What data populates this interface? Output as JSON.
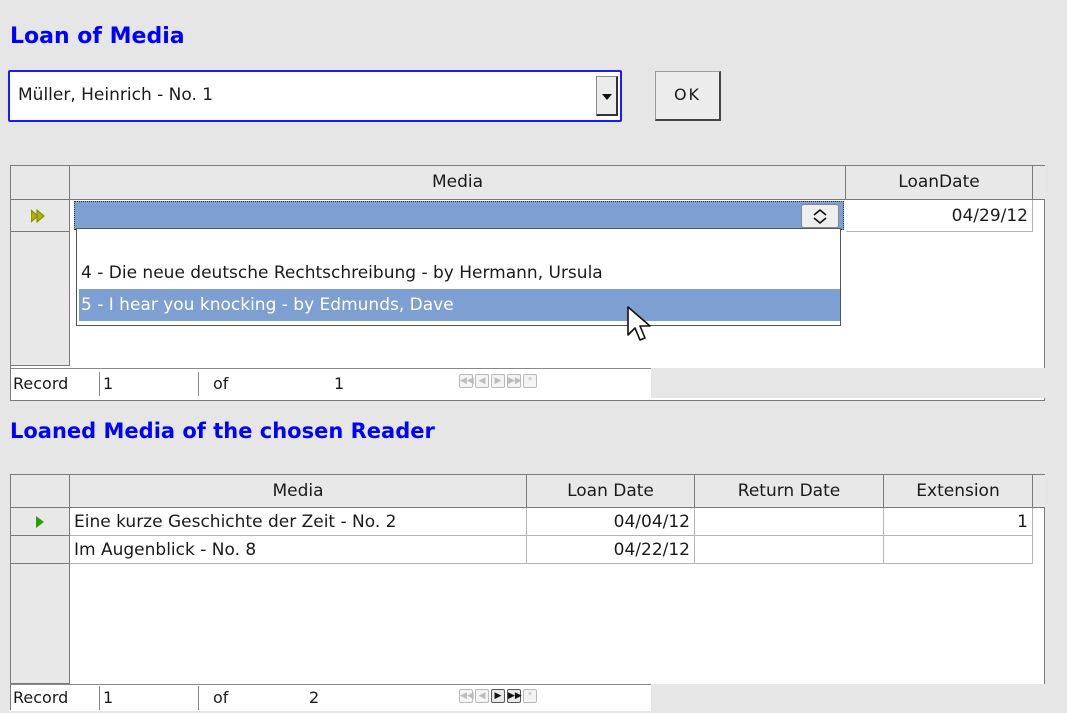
{
  "loan_form": {
    "title": "Loan of Media",
    "reader_select": {
      "value": "Müller, Heinrich - No. 1"
    },
    "ok_label": "OK"
  },
  "loan_grid": {
    "columns": [
      "Media",
      "LoanDate"
    ],
    "row": {
      "media": "",
      "loan_date": "04/29/12"
    },
    "dropdown_items": [
      "4 - Die neue deutsche Rechtschreibung - by Hermann, Ursula",
      "5 - I hear you knocking - by Edmunds, Dave"
    ],
    "selected_item_index": 1,
    "navigator": {
      "record_label": "Record",
      "current": "1",
      "of_label": "of",
      "total": "1"
    }
  },
  "loaned_section": {
    "title": "Loaned Media of the chosen Reader",
    "columns": [
      "Media",
      "Loan Date",
      "Return Date",
      "Extension"
    ],
    "rows": [
      {
        "media": "Eine kurze Geschichte der Zeit - No. 2",
        "loan_date": "04/04/12",
        "return_date": "",
        "extension": "1"
      },
      {
        "media": "Im Augenblick - No. 8",
        "loan_date": "04/22/12",
        "return_date": "",
        "extension": ""
      }
    ],
    "navigator": {
      "record_label": "Record",
      "current": "1",
      "of_label": "of",
      "total": "2"
    }
  },
  "icons": {
    "current_record_new": "double-arrow-icon",
    "current_record": "play-arrow-icon",
    "spin": "spin-updown-icon",
    "cursor": "mouse-pointer-icon",
    "nav": [
      "first-record-icon",
      "previous-record-icon",
      "next-record-icon",
      "last-record-icon",
      "new-record-icon"
    ]
  },
  "colors": {
    "heading": "#0000ff",
    "selection": "#7e9fd1",
    "focus_border": "#1a1aff",
    "record_marker": "#2aa000"
  }
}
